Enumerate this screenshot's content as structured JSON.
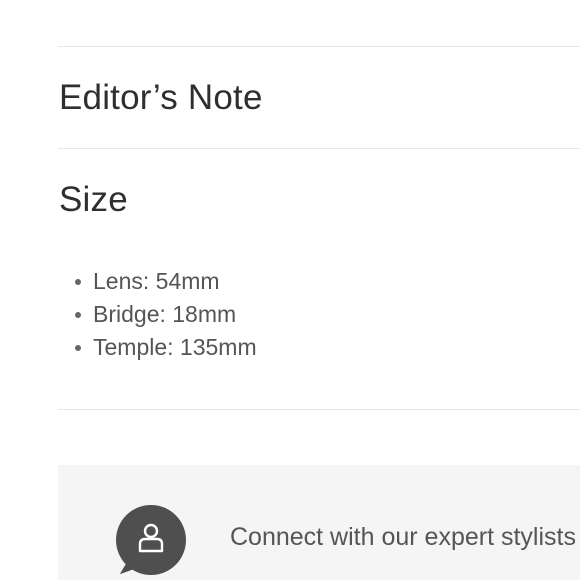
{
  "sections": {
    "editors_note": {
      "title": "Editor’s Note"
    },
    "size": {
      "title": "Size",
      "items": [
        {
          "label": "Lens: 54mm"
        },
        {
          "label": "Bridge: 18mm"
        },
        {
          "label": "Temple: 135mm"
        }
      ]
    }
  },
  "stylist_banner": {
    "icon": "person-chat-icon",
    "text": "Connect with our expert stylists"
  },
  "colors": {
    "banner_background": "#f5f5f5",
    "bubble": "#4f4f4f",
    "divider": "#e6e6e6"
  }
}
